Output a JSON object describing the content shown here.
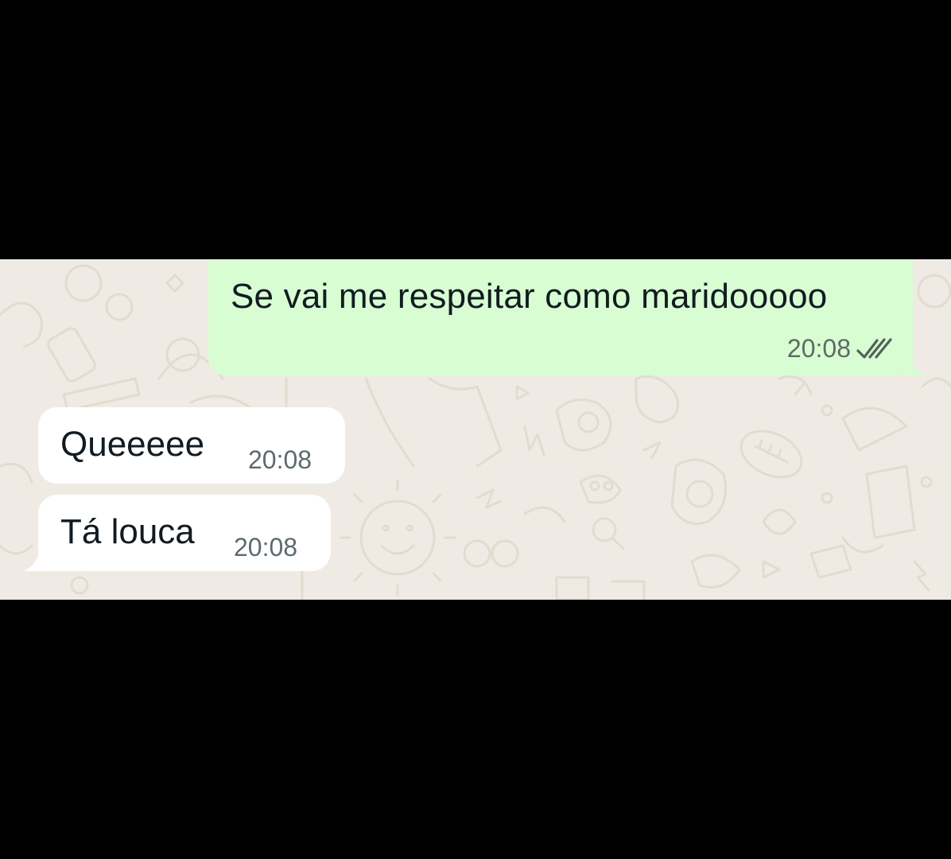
{
  "chat": {
    "messages": [
      {
        "direction": "outgoing",
        "text": "Se vai me respeitar como maridooooo",
        "time": "20:08",
        "status_icon": "double-check-read-icon"
      },
      {
        "direction": "incoming",
        "text": "Queeeee",
        "time": "20:08"
      },
      {
        "direction": "incoming",
        "text": "Tá louca",
        "time": "20:08"
      }
    ]
  },
  "colors": {
    "background_letterbox": "#000000",
    "chat_wallpaper": "#efebe4",
    "outgoing_bubble": "#d9fdd3",
    "incoming_bubble": "#ffffff",
    "text": "#111b21",
    "timestamp": "#5c6b64"
  }
}
